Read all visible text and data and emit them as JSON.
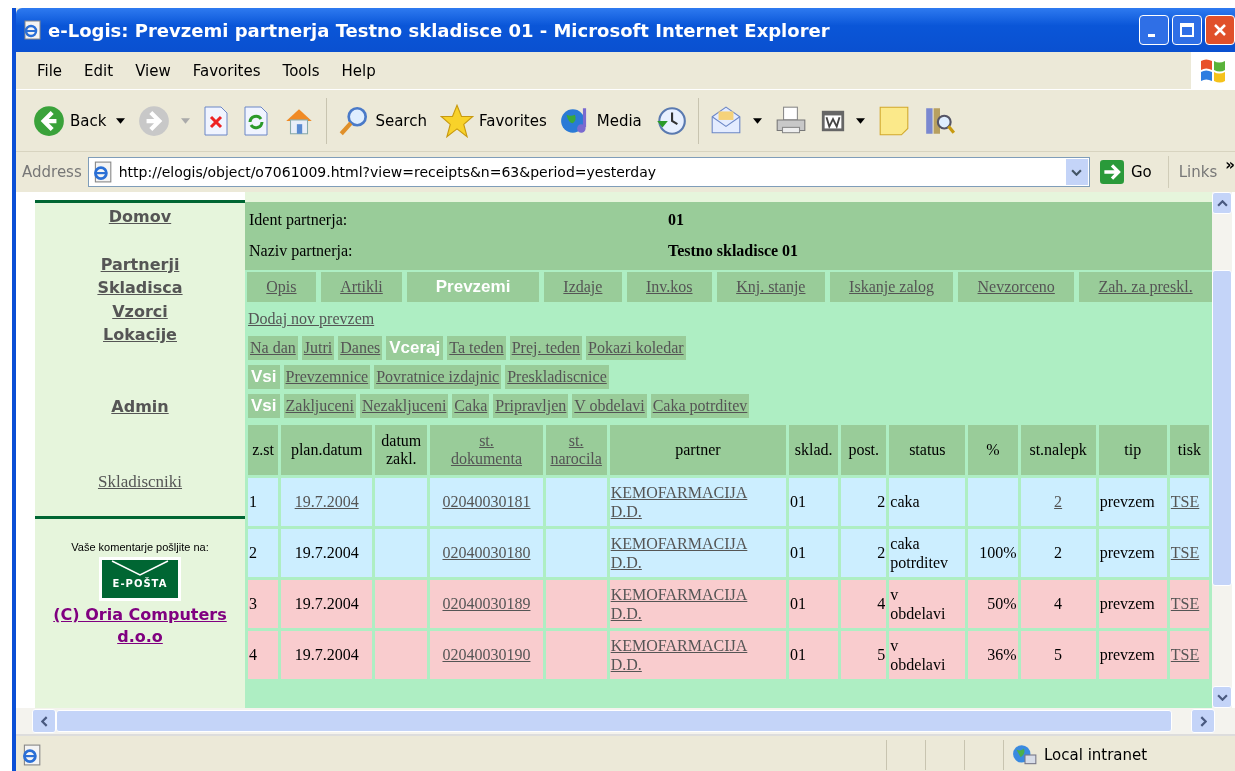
{
  "window": {
    "title": "e-Logis: Prevzemi partnerja Testno skladisce 01 - Microsoft Internet Explorer"
  },
  "menu": [
    "File",
    "Edit",
    "View",
    "Favorites",
    "Tools",
    "Help"
  ],
  "toolbar": [
    {
      "kind": "back",
      "label": "Back"
    },
    {
      "kind": "forward"
    },
    {
      "kind": "stop"
    },
    {
      "kind": "refresh"
    },
    {
      "kind": "home"
    },
    {
      "kind": "search",
      "label": "Search"
    },
    {
      "kind": "favorites",
      "label": "Favorites"
    },
    {
      "kind": "media",
      "label": "Media"
    },
    {
      "kind": "history"
    },
    {
      "kind": "mail"
    },
    {
      "kind": "print"
    },
    {
      "kind": "edit"
    },
    {
      "kind": "notes"
    },
    {
      "kind": "research"
    }
  ],
  "address": {
    "label": "Address",
    "url": "http://elogis/object/o7061009.html?view=receipts&n=63&period=yesterday",
    "go": "Go",
    "links": "Links",
    "more": "»"
  },
  "sidebar": {
    "groups": [
      {
        "kind": "main",
        "items": [
          "Domov"
        ]
      },
      {
        "kind": "main",
        "items": [
          "Partnerji",
          "Skladisca",
          "Vzorci",
          "Lokacije"
        ]
      },
      {
        "kind": "main",
        "items": [
          "Admin"
        ]
      },
      {
        "kind": "serif",
        "items": [
          "Skladiscniki"
        ]
      }
    ],
    "comment": "Vaše komentarje pošljite na:",
    "email": "E-POŠTA",
    "copyright": "(C) Oria Computers d.o.o"
  },
  "partner": {
    "ident_label": "Ident partnerja:",
    "ident": "01",
    "name_label": "Naziv partnerja:",
    "name": "Testno skladisce 01"
  },
  "tabs": [
    {
      "label": "Opis",
      "selected": false
    },
    {
      "label": "Artikli",
      "selected": false
    },
    {
      "label": "Prevzemi",
      "selected": true
    },
    {
      "label": "Izdaje",
      "selected": false
    },
    {
      "label": "Inv.kos",
      "selected": false
    },
    {
      "label": "Knj. stanje",
      "selected": false
    },
    {
      "label": "Iskanje zalog",
      "selected": false
    },
    {
      "label": "Nevzorceno",
      "selected": false
    },
    {
      "label": "Zah. za preskl.",
      "selected": false
    }
  ],
  "add_link": "Dodaj nov prevzem",
  "filter_rows": [
    {
      "items": [
        {
          "label": "Na dan",
          "selected": false
        },
        {
          "label": "Jutri",
          "selected": false
        },
        {
          "label": "Danes",
          "selected": false
        },
        {
          "label": "Vceraj",
          "selected": true
        },
        {
          "label": "Ta teden",
          "selected": false
        },
        {
          "label": "Prej. teden",
          "selected": false
        },
        {
          "label": "Pokazi koledar",
          "selected": false
        }
      ]
    },
    {
      "items": [
        {
          "label": "Vsi",
          "selected": true
        },
        {
          "label": "Prevzemnice",
          "selected": false
        },
        {
          "label": "Povratnice izdajnic",
          "selected": false
        },
        {
          "label": "Preskladiscnice",
          "selected": false
        }
      ]
    },
    {
      "items": [
        {
          "label": "Vsi",
          "selected": true
        },
        {
          "label": "Zakljuceni",
          "selected": false
        },
        {
          "label": "Nezakljuceni",
          "selected": false
        },
        {
          "label": "Caka",
          "selected": false
        },
        {
          "label": "Pripravljen",
          "selected": false
        },
        {
          "label": "V obdelavi",
          "selected": false
        },
        {
          "label": "Caka potrditev",
          "selected": false
        }
      ]
    }
  ],
  "table": {
    "columns": [
      {
        "label": "z.st",
        "sortable": false
      },
      {
        "label": "plan.datum",
        "sortable": false
      },
      {
        "label": "datum zakl.",
        "sortable": false
      },
      {
        "label": "st. dokumenta",
        "sortable": true
      },
      {
        "label": "st. narocila",
        "sortable": true
      },
      {
        "label": "partner",
        "sortable": false
      },
      {
        "label": "sklad.",
        "sortable": false
      },
      {
        "label": "post.",
        "sortable": false
      },
      {
        "label": "status",
        "sortable": false
      },
      {
        "label": "%",
        "sortable": false
      },
      {
        "label": "st.nalepk",
        "sortable": false
      },
      {
        "label": "tip",
        "sortable": false
      },
      {
        "label": "tisk",
        "sortable": false
      }
    ],
    "rows": [
      {
        "color": "#cceeff",
        "cells": [
          {
            "kind": "text",
            "text": "1"
          },
          {
            "kind": "link",
            "text": "19.7.2004"
          },
          {
            "kind": "empty"
          },
          {
            "kind": "link",
            "text": "02040030181"
          },
          {
            "kind": "empty"
          },
          {
            "kind": "link",
            "text": "KEMOFARMACIJA D.D."
          },
          {
            "kind": "text",
            "text": "01"
          },
          {
            "kind": "text",
            "text": "2"
          },
          {
            "kind": "text",
            "text": "caka"
          },
          {
            "kind": "empty"
          },
          {
            "kind": "link",
            "text": "2"
          },
          {
            "kind": "text",
            "text": "prevzem"
          },
          {
            "kind": "link",
            "text": "TSE"
          }
        ]
      },
      {
        "color": "#cceeff",
        "cells": [
          {
            "kind": "text",
            "text": "2"
          },
          {
            "kind": "text",
            "text": "19.7.2004"
          },
          {
            "kind": "empty"
          },
          {
            "kind": "link",
            "text": "02040030180"
          },
          {
            "kind": "empty"
          },
          {
            "kind": "link",
            "text": "KEMOFARMACIJA D.D."
          },
          {
            "kind": "text",
            "text": "01"
          },
          {
            "kind": "text",
            "text": "2"
          },
          {
            "kind": "text",
            "text": "caka potrditev"
          },
          {
            "kind": "text",
            "text": "100%"
          },
          {
            "kind": "text",
            "text": "2"
          },
          {
            "kind": "text",
            "text": "prevzem"
          },
          {
            "kind": "link",
            "text": "TSE"
          }
        ]
      },
      {
        "color": "#f9ccce",
        "cells": [
          {
            "kind": "text",
            "text": "3"
          },
          {
            "kind": "text",
            "text": "19.7.2004"
          },
          {
            "kind": "empty"
          },
          {
            "kind": "link",
            "text": "02040030189"
          },
          {
            "kind": "empty"
          },
          {
            "kind": "link",
            "text": "KEMOFARMACIJA D.D."
          },
          {
            "kind": "text",
            "text": "01"
          },
          {
            "kind": "text",
            "text": "4"
          },
          {
            "kind": "text",
            "text": "v obdelavi"
          },
          {
            "kind": "text",
            "text": "50%"
          },
          {
            "kind": "text",
            "text": "4"
          },
          {
            "kind": "text",
            "text": "prevzem"
          },
          {
            "kind": "link",
            "text": "TSE"
          }
        ]
      },
      {
        "color": "#f9ccce",
        "cells": [
          {
            "kind": "text",
            "text": "4"
          },
          {
            "kind": "text",
            "text": "19.7.2004"
          },
          {
            "kind": "empty"
          },
          {
            "kind": "link",
            "text": "02040030190"
          },
          {
            "kind": "empty"
          },
          {
            "kind": "link",
            "text": "KEMOFARMACIJA D.D."
          },
          {
            "kind": "text",
            "text": "01"
          },
          {
            "kind": "text",
            "text": "5"
          },
          {
            "kind": "text",
            "text": "v obdelavi"
          },
          {
            "kind": "text",
            "text": "36%"
          },
          {
            "kind": "text",
            "text": "5"
          },
          {
            "kind": "text",
            "text": "prevzem"
          },
          {
            "kind": "link",
            "text": "TSE"
          }
        ]
      }
    ]
  },
  "status_bar": {
    "zone": "Local intranet"
  }
}
